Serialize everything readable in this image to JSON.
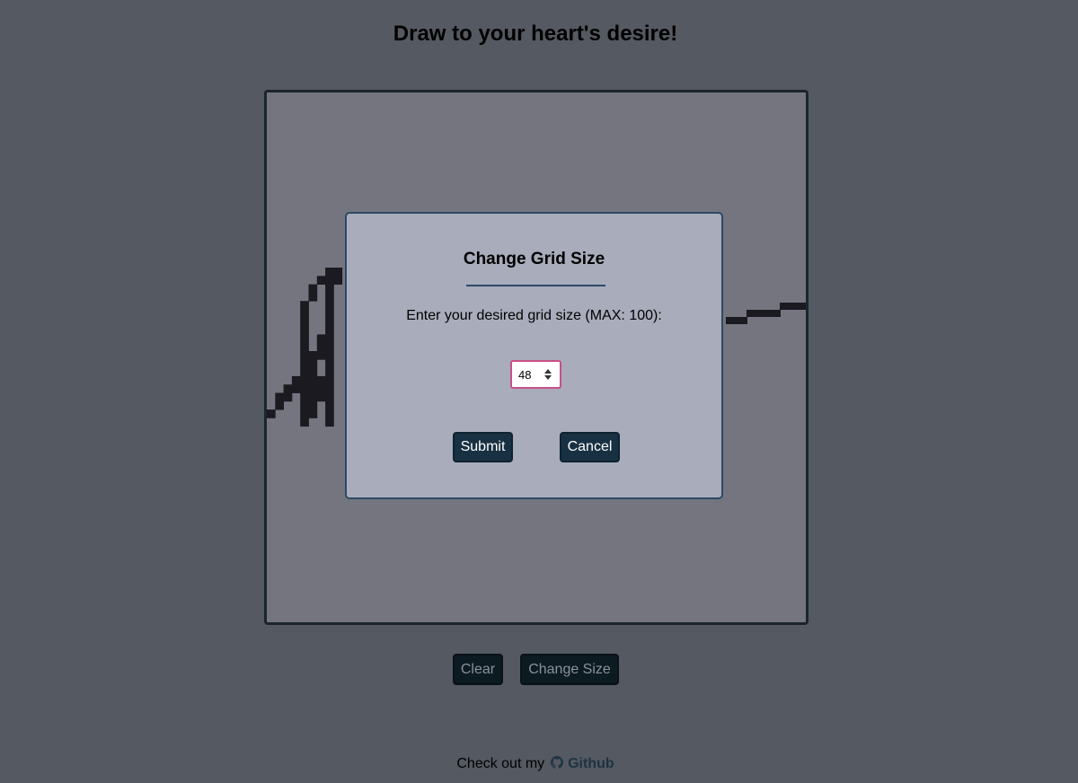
{
  "header": {
    "title": "Draw to your heart's desire!"
  },
  "canvas": {
    "grid_size": 48,
    "background_color": "#75757f",
    "ink_color": "#1a1a20",
    "border_color": "#1b252e"
  },
  "modal": {
    "title": "Change Grid Size",
    "prompt": "Enter your desired grid size (MAX: 100):",
    "input_value": "48",
    "submit_label": "Submit",
    "cancel_label": "Cancel"
  },
  "controls": {
    "clear_label": "Clear",
    "change_size_label": "Change Size"
  },
  "footer": {
    "text": "Check out my",
    "link_label": "Github",
    "icon": "github-icon"
  },
  "colors": {
    "page_background": "#555961",
    "modal_background": "#a9acbb",
    "button_background": "#183142",
    "input_focus": "#c8508a"
  }
}
